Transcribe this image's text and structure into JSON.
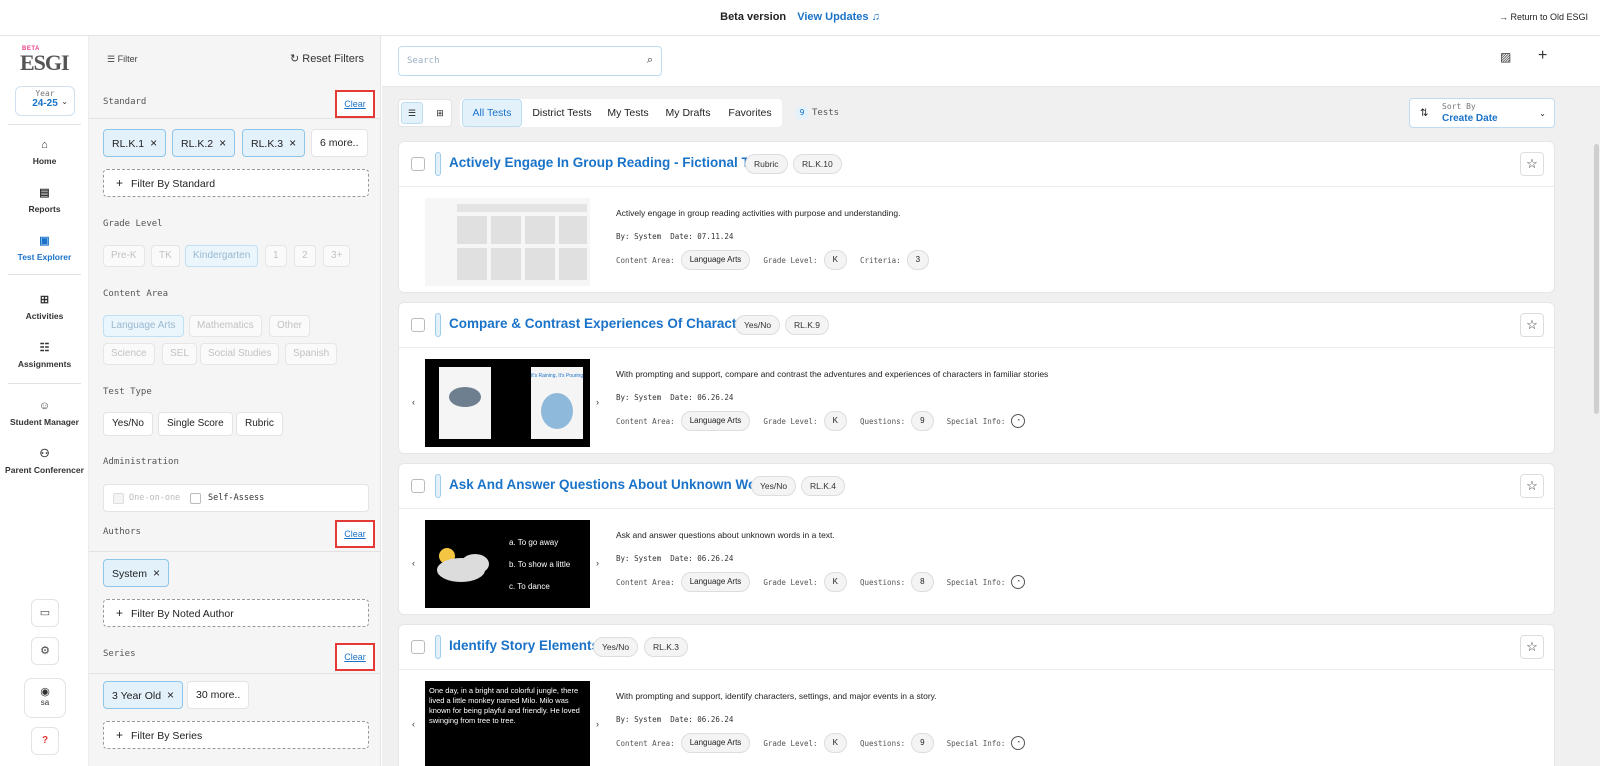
{
  "topbar": {
    "beta": "Beta version",
    "updates": "View Updates",
    "return": "Return to Old ESGI"
  },
  "nav": {
    "logo_beta": "BETA",
    "logo_text": "ESGI",
    "year_label": "Year",
    "year_value": "24-25",
    "items": [
      {
        "label": "Home",
        "icon": "home-icon"
      },
      {
        "label": "Reports",
        "icon": "reports-icon"
      },
      {
        "label": "Test Explorer",
        "icon": "test-explorer-icon"
      },
      {
        "label": "Activities",
        "icon": "activities-icon"
      },
      {
        "label": "Assignments",
        "icon": "assignments-icon"
      },
      {
        "label": "Student Manager",
        "icon": "student-manager-icon"
      },
      {
        "label": "Parent Conferencer",
        "icon": "parent-conferencer-icon"
      }
    ],
    "user": "sa",
    "help": "?"
  },
  "filters": {
    "filter_label": "Filter",
    "reset_label": "Reset Filters",
    "clear_label": "Clear",
    "standard": {
      "title": "Standard",
      "chips": [
        "RL.K.1",
        "RL.K.2",
        "RL.K.3"
      ],
      "more": "6 more..",
      "add": "Filter By Standard"
    },
    "grade": {
      "title": "Grade Level",
      "options": [
        "Pre-K",
        "TK",
        "Kindergarten",
        "1",
        "2",
        "3+"
      ],
      "selected": "Kindergarten"
    },
    "content": {
      "title": "Content Area",
      "row1": [
        "Language Arts",
        "Mathematics",
        "Other"
      ],
      "row2": [
        "Science",
        "SEL",
        "Social Studies",
        "Spanish"
      ],
      "selected": "Language Arts"
    },
    "test_type": {
      "title": "Test Type",
      "options": [
        "Yes/No",
        "Single Score",
        "Rubric"
      ]
    },
    "administration": {
      "title": "Administration",
      "one_on_one": "One-on-one",
      "self_assess": "Self-Assess"
    },
    "authors": {
      "title": "Authors",
      "chips": [
        "System"
      ],
      "add": "Filter By Noted Author"
    },
    "series": {
      "title": "Series",
      "chips": [
        "3 Year Old"
      ],
      "more": "30 more..",
      "add": "Filter By Series"
    }
  },
  "main": {
    "search_placeholder": "Search",
    "tabs": [
      "All Tests",
      "District Tests",
      "My Tests",
      "My Drafts",
      "Favorites"
    ],
    "active_tab": "All Tests",
    "test_count": "9",
    "test_count_label": "Tests",
    "sort_label": "Sort By",
    "sort_value": "Create Date",
    "labels": {
      "by": "By:",
      "date": "Date:",
      "content_area": "Content Area:",
      "grade_level": "Grade Level:",
      "questions": "Questions:",
      "criteria": "Criteria:",
      "special_info": "Special Info:"
    },
    "cards": [
      {
        "title": "Actively Engage In Group Reading - Fictional Text",
        "type": "Rubric",
        "standard": "RL.K.10",
        "description": "Actively engage in group reading activities with purpose and understanding.",
        "author": "System",
        "date": "07.11.24",
        "content_area": "Language Arts",
        "grade": "K",
        "count_label": "criteria",
        "count": "3"
      },
      {
        "title": "Compare & Contrast Experiences Of Characters",
        "type": "Yes/No",
        "standard": "RL.K.9",
        "description": "With prompting and support, compare and contrast the adventures and experiences of characters in familiar stories",
        "author": "System",
        "date": "06.26.24",
        "content_area": "Language Arts",
        "grade": "K",
        "count_label": "questions",
        "count": "9",
        "thumb_text": "It's Raining, It's Pouring"
      },
      {
        "title": "Ask And Answer Questions About Unknown Words",
        "type": "Yes/No",
        "standard": "RL.K.4",
        "description": "Ask and answer questions about unknown words in a text.",
        "author": "System",
        "date": "06.26.24",
        "content_area": "Language Arts",
        "grade": "K",
        "count_label": "questions",
        "count": "8",
        "thumb_lines": [
          "a. To go away",
          "b. To show a little",
          "c. To dance"
        ]
      },
      {
        "title": "Identify Story Elements",
        "type": "Yes/No",
        "standard": "RL.K.3",
        "description": "With prompting and support, identify characters, settings, and major events in a story.",
        "author": "System",
        "date": "06.26.24",
        "content_area": "Language Arts",
        "grade": "K",
        "count_label": "questions",
        "count": "9",
        "thumb_text": "One day, in a bright and colorful jungle, there lived a little monkey named Milo. Milo was known for being playful and friendly. He loved swinging from tree to tree."
      }
    ]
  }
}
